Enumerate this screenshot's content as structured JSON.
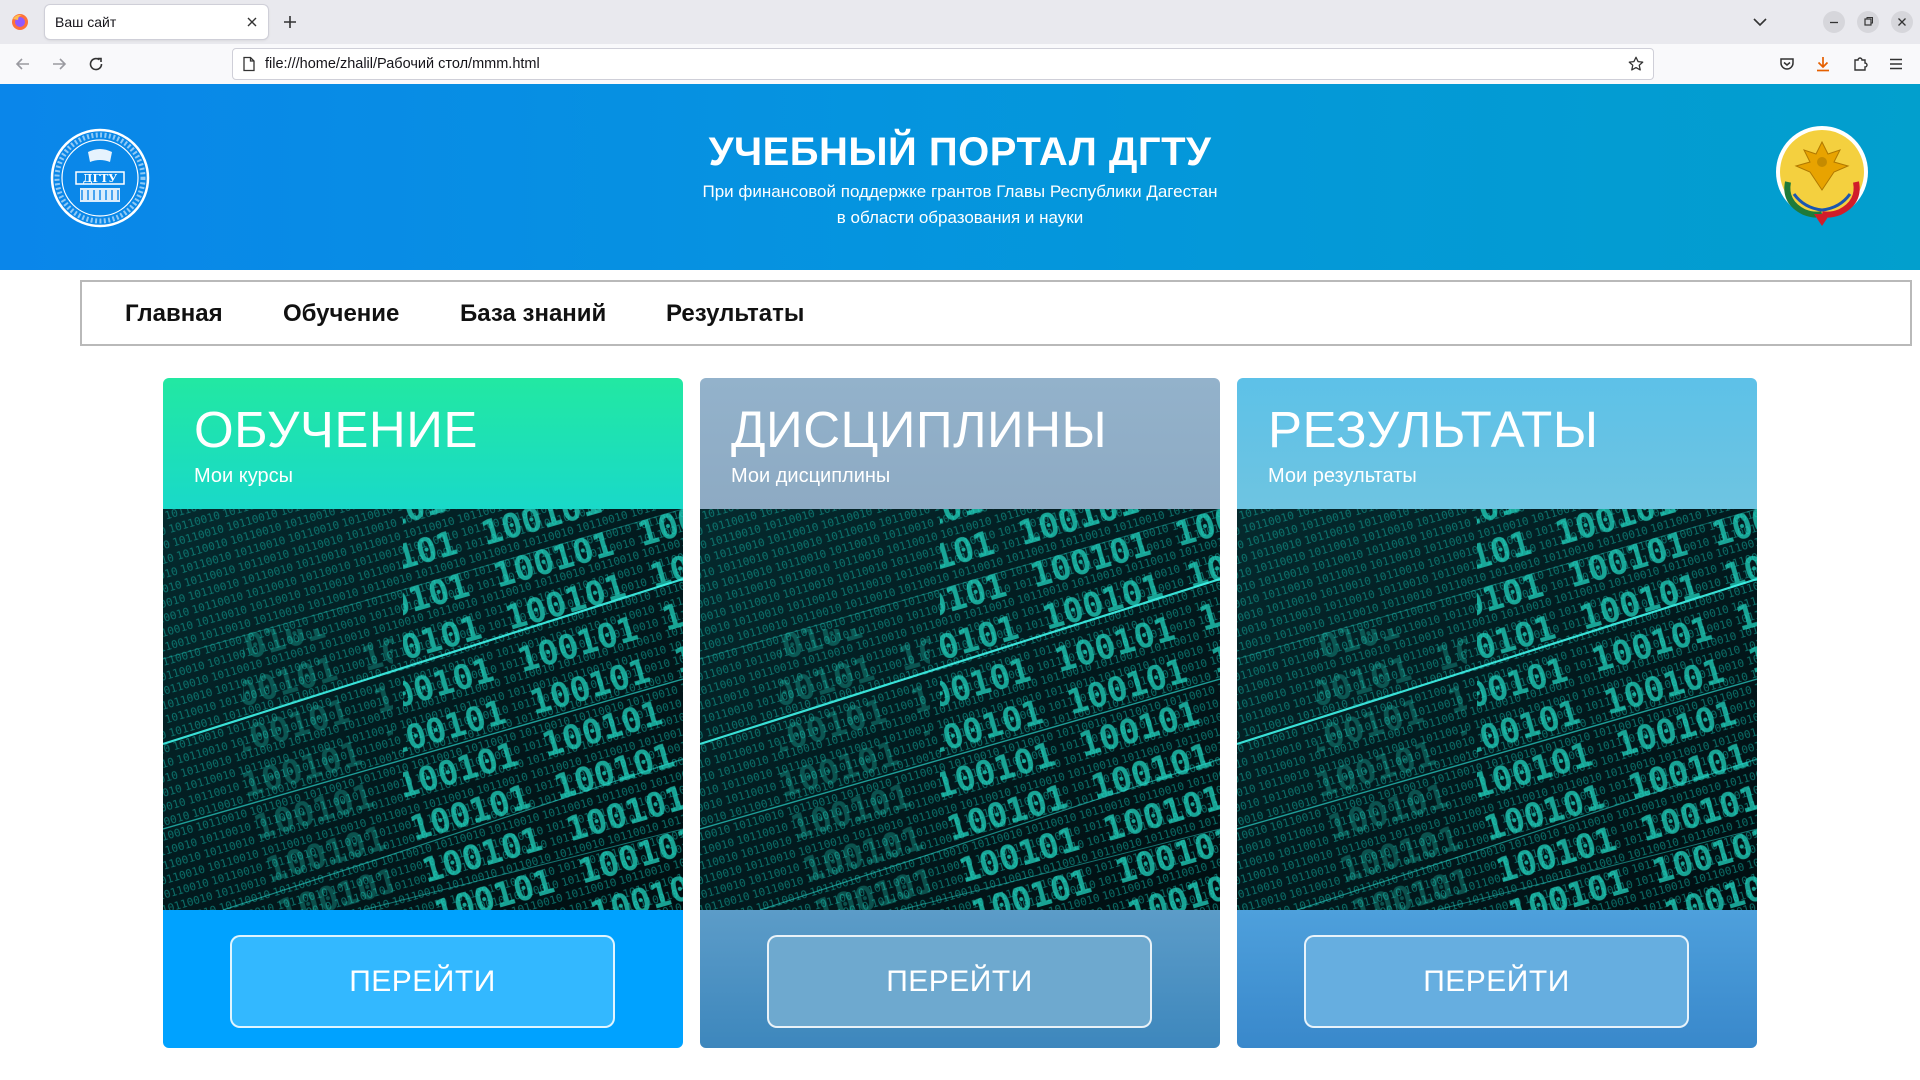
{
  "browser": {
    "tab_title": "Ваш сайт",
    "url": "file:///home/zhalil/Рабочий стол/mmm.html"
  },
  "header": {
    "title": "УЧЕБНЫЙ ПОРТАЛ ДГТУ",
    "subtitle_line1": "При финансовой поддержке грантов Главы Республики Дагестан",
    "subtitle_line2": "в области образования и науки",
    "logo_left_text": "ДГТУ"
  },
  "menu": {
    "items": [
      {
        "label": "Главная"
      },
      {
        "label": "Обучение"
      },
      {
        "label": "База знаний"
      },
      {
        "label": "Результаты"
      }
    ]
  },
  "cards": [
    {
      "title": "ОБУЧЕНИЕ",
      "subtitle": "Мои курсы",
      "button": "ПЕРЕЙТИ"
    },
    {
      "title": "ДИСЦИПЛИНЫ",
      "subtitle": "Мои дисциплины",
      "button": "ПЕРЕЙТИ"
    },
    {
      "title": "РЕЗУЛЬТАТЫ",
      "subtitle": "Мои результаты",
      "button": "ПЕРЕЙТИ"
    }
  ],
  "icons": {
    "browser": [
      "firefox-logo-icon",
      "close-icon",
      "plus-icon",
      "chevron-down-icon",
      "minimize-icon",
      "restore-icon",
      "back-arrow-icon",
      "forward-arrow-icon",
      "reload-icon",
      "page-icon",
      "bookmark-star-icon",
      "pocket-icon",
      "download-icon",
      "extensions-icon",
      "hamburger-menu-icon"
    ],
    "page": [
      "university-emblem-icon",
      "dagestan-coat-of-arms-icon",
      "binary-code-image"
    ]
  },
  "colors": {
    "header_blue": "#0a86ea",
    "card1_top": "#22e8a2",
    "card1_bottom": "#00a2ff",
    "card2_top": "#93b2cb",
    "card2_bottom": "#3d87bd",
    "card3_top": "#5dc1e8",
    "card3_bottom": "#3988cb",
    "download_accent": "#e66000"
  }
}
